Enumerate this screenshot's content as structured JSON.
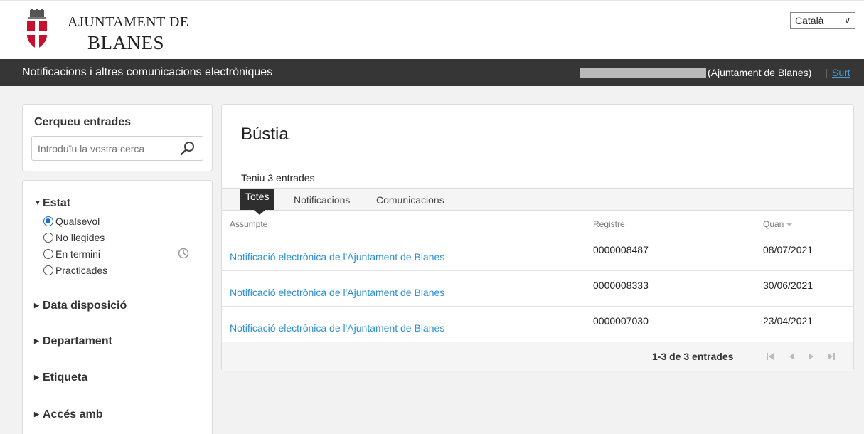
{
  "header": {
    "brand_line1": "AJUNTAMENT DE",
    "brand_line2": "BLANES",
    "language": "Català"
  },
  "navbar": {
    "title": "Notificacions i altres comunicacions electròniques",
    "user_org": "(Ajuntament de Blanes)",
    "separator": "|",
    "logout": "Surt"
  },
  "search": {
    "title": "Cerqueu entrades",
    "placeholder": "Introduïu la vostra cerca"
  },
  "filters": {
    "status_title": "Estat",
    "status_options": [
      "Qualsevol",
      "No llegides",
      "En termini",
      "Practicades"
    ],
    "selected_index": 0,
    "sections": [
      "Data disposició",
      "Departament",
      "Etiqueta",
      "Accés amb"
    ]
  },
  "main": {
    "title": "Bústia",
    "count_text": "Teniu 3 entrades",
    "tabs": [
      "Totes",
      "Notificacions",
      "Comunicacions"
    ],
    "active_tab": 0,
    "columns": [
      "Assumpte",
      "Registre",
      "Quan"
    ],
    "rows": [
      {
        "subject": "Notificació electrònica de l'Ajuntament de Blanes",
        "registry": "0000008487",
        "date": "08/07/2021"
      },
      {
        "subject": "Notificació electrònica de l'Ajuntament de Blanes",
        "registry": "0000008333",
        "date": "30/06/2021"
      },
      {
        "subject": "Notificació electrònica de l'Ajuntament de Blanes",
        "registry": "0000007030",
        "date": "23/04/2021"
      }
    ],
    "pager_text": "1-3 de 3 entrades"
  },
  "colors": {
    "navbar_bg": "#363636",
    "link": "#2a8fd0",
    "radio_selected": "#1e6fd0",
    "logo_red": "#c8102e"
  }
}
